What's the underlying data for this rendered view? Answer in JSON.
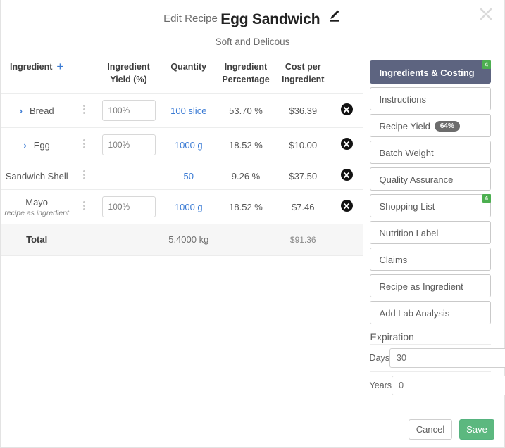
{
  "header": {
    "title_prefix": "Edit Recipe",
    "title": "Egg Sandwich",
    "subtitle": "Soft and Delicous",
    "edit_icon": "pencil-icon",
    "close_icon": "close-icon"
  },
  "table": {
    "columns": {
      "ingredient": "Ingredient",
      "add_icon": "+",
      "yield": "Ingredient\nYield (%)",
      "yield_line1": "Ingredient",
      "yield_line2": "Yield (%)",
      "quantity": "Quantity",
      "percentage_line1": "Ingredient",
      "percentage_line2": "Percentage",
      "cost_line1": "Cost per",
      "cost_line2": "Ingredient"
    },
    "rows": [
      {
        "name": "Bread",
        "expandable": true,
        "chevron": "›",
        "note": "",
        "yield_value": "100%",
        "has_yield": true,
        "quantity": "100 slice",
        "percentage": "53.70 %",
        "cost": "$36.39"
      },
      {
        "name": "Egg",
        "expandable": true,
        "chevron": "›",
        "note": "",
        "yield_value": "100%",
        "has_yield": true,
        "quantity": "1000 g",
        "percentage": "18.52 %",
        "cost": "$10.00"
      },
      {
        "name": "Sandwich Shell",
        "expandable": false,
        "chevron": "",
        "note": "",
        "yield_value": "",
        "has_yield": false,
        "quantity": "50",
        "percentage": "9.26 %",
        "cost": "$37.50"
      },
      {
        "name": "Mayo",
        "expandable": false,
        "chevron": "",
        "note": "recipe as ingredient",
        "yield_value": "100%",
        "has_yield": true,
        "quantity": "1000 g",
        "percentage": "18.52 %",
        "cost": "$7.46"
      }
    ],
    "total": {
      "label": "Total",
      "quantity": "5.4000 kg",
      "cost": "$91.36"
    }
  },
  "sidebar": {
    "items": [
      {
        "label": "Ingredients & Costing",
        "active": true,
        "badge": "4",
        "pill": ""
      },
      {
        "label": "Instructions",
        "active": false,
        "badge": "",
        "pill": ""
      },
      {
        "label": "Recipe Yield",
        "active": false,
        "badge": "",
        "pill": "64%"
      },
      {
        "label": "Batch Weight",
        "active": false,
        "badge": "",
        "pill": ""
      },
      {
        "label": "Quality Assurance",
        "active": false,
        "badge": "",
        "pill": ""
      },
      {
        "label": "Shopping List",
        "active": false,
        "badge": "4",
        "pill": ""
      },
      {
        "label": "Nutrition Label",
        "active": false,
        "badge": "",
        "pill": ""
      },
      {
        "label": "Claims",
        "active": false,
        "badge": "",
        "pill": ""
      },
      {
        "label": "Recipe as Ingredient",
        "active": false,
        "badge": "",
        "pill": ""
      },
      {
        "label": "Add Lab Analysis",
        "active": false,
        "badge": "",
        "pill": ""
      }
    ],
    "expiration": {
      "title": "Expiration",
      "days_label": "Days",
      "days_value": "30",
      "years_label": "Years",
      "years_value": "0"
    }
  },
  "footer": {
    "cancel_label": "Cancel",
    "save_label": "Save"
  },
  "colors": {
    "accent_blue": "#3b7bd4",
    "sidebar_active": "#5d6480",
    "badge_green": "#4caf50",
    "save_green": "#5cb87f"
  }
}
